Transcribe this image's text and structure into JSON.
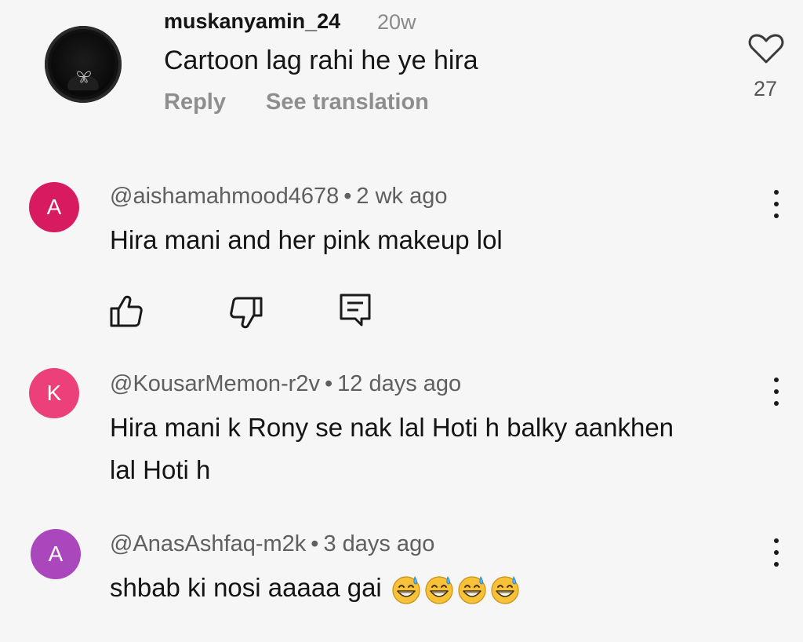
{
  "instagram_comment": {
    "username": "muskanyamin_24",
    "time": "20w",
    "text": "Cartoon lag rahi he ye hira",
    "reply_label": "Reply",
    "translate_label": "See translation",
    "like_count": "27"
  },
  "youtube_comments": [
    {
      "avatar_letter": "A",
      "avatar_color": "#d81b60",
      "handle": "@aishamahmood4678",
      "time": "2 wk ago",
      "text": "Hira mani and her pink makeup lol"
    },
    {
      "avatar_letter": "K",
      "avatar_color": "#ec407a",
      "handle": "@KousarMemon-r2v",
      "time": "12 days ago",
      "text_line1": "Hira mani k Rony se nak lal Hoti h balky aankhen",
      "text_line2": "lal Hoti h"
    },
    {
      "avatar_letter": "A",
      "avatar_color": "#ab47bc",
      "handle": "@AnasAshfaq-m2k",
      "time": "3 days ago",
      "text": "shbab ki nosi aaaaa gai"
    }
  ],
  "separator": "•",
  "icons": {
    "like": "thumbs-up-icon",
    "dislike": "thumbs-down-icon",
    "reply": "comment-icon",
    "menu": "more-vert-icon",
    "heart": "heart-outline-icon",
    "emoji": "grinning-sweat-emoji"
  }
}
